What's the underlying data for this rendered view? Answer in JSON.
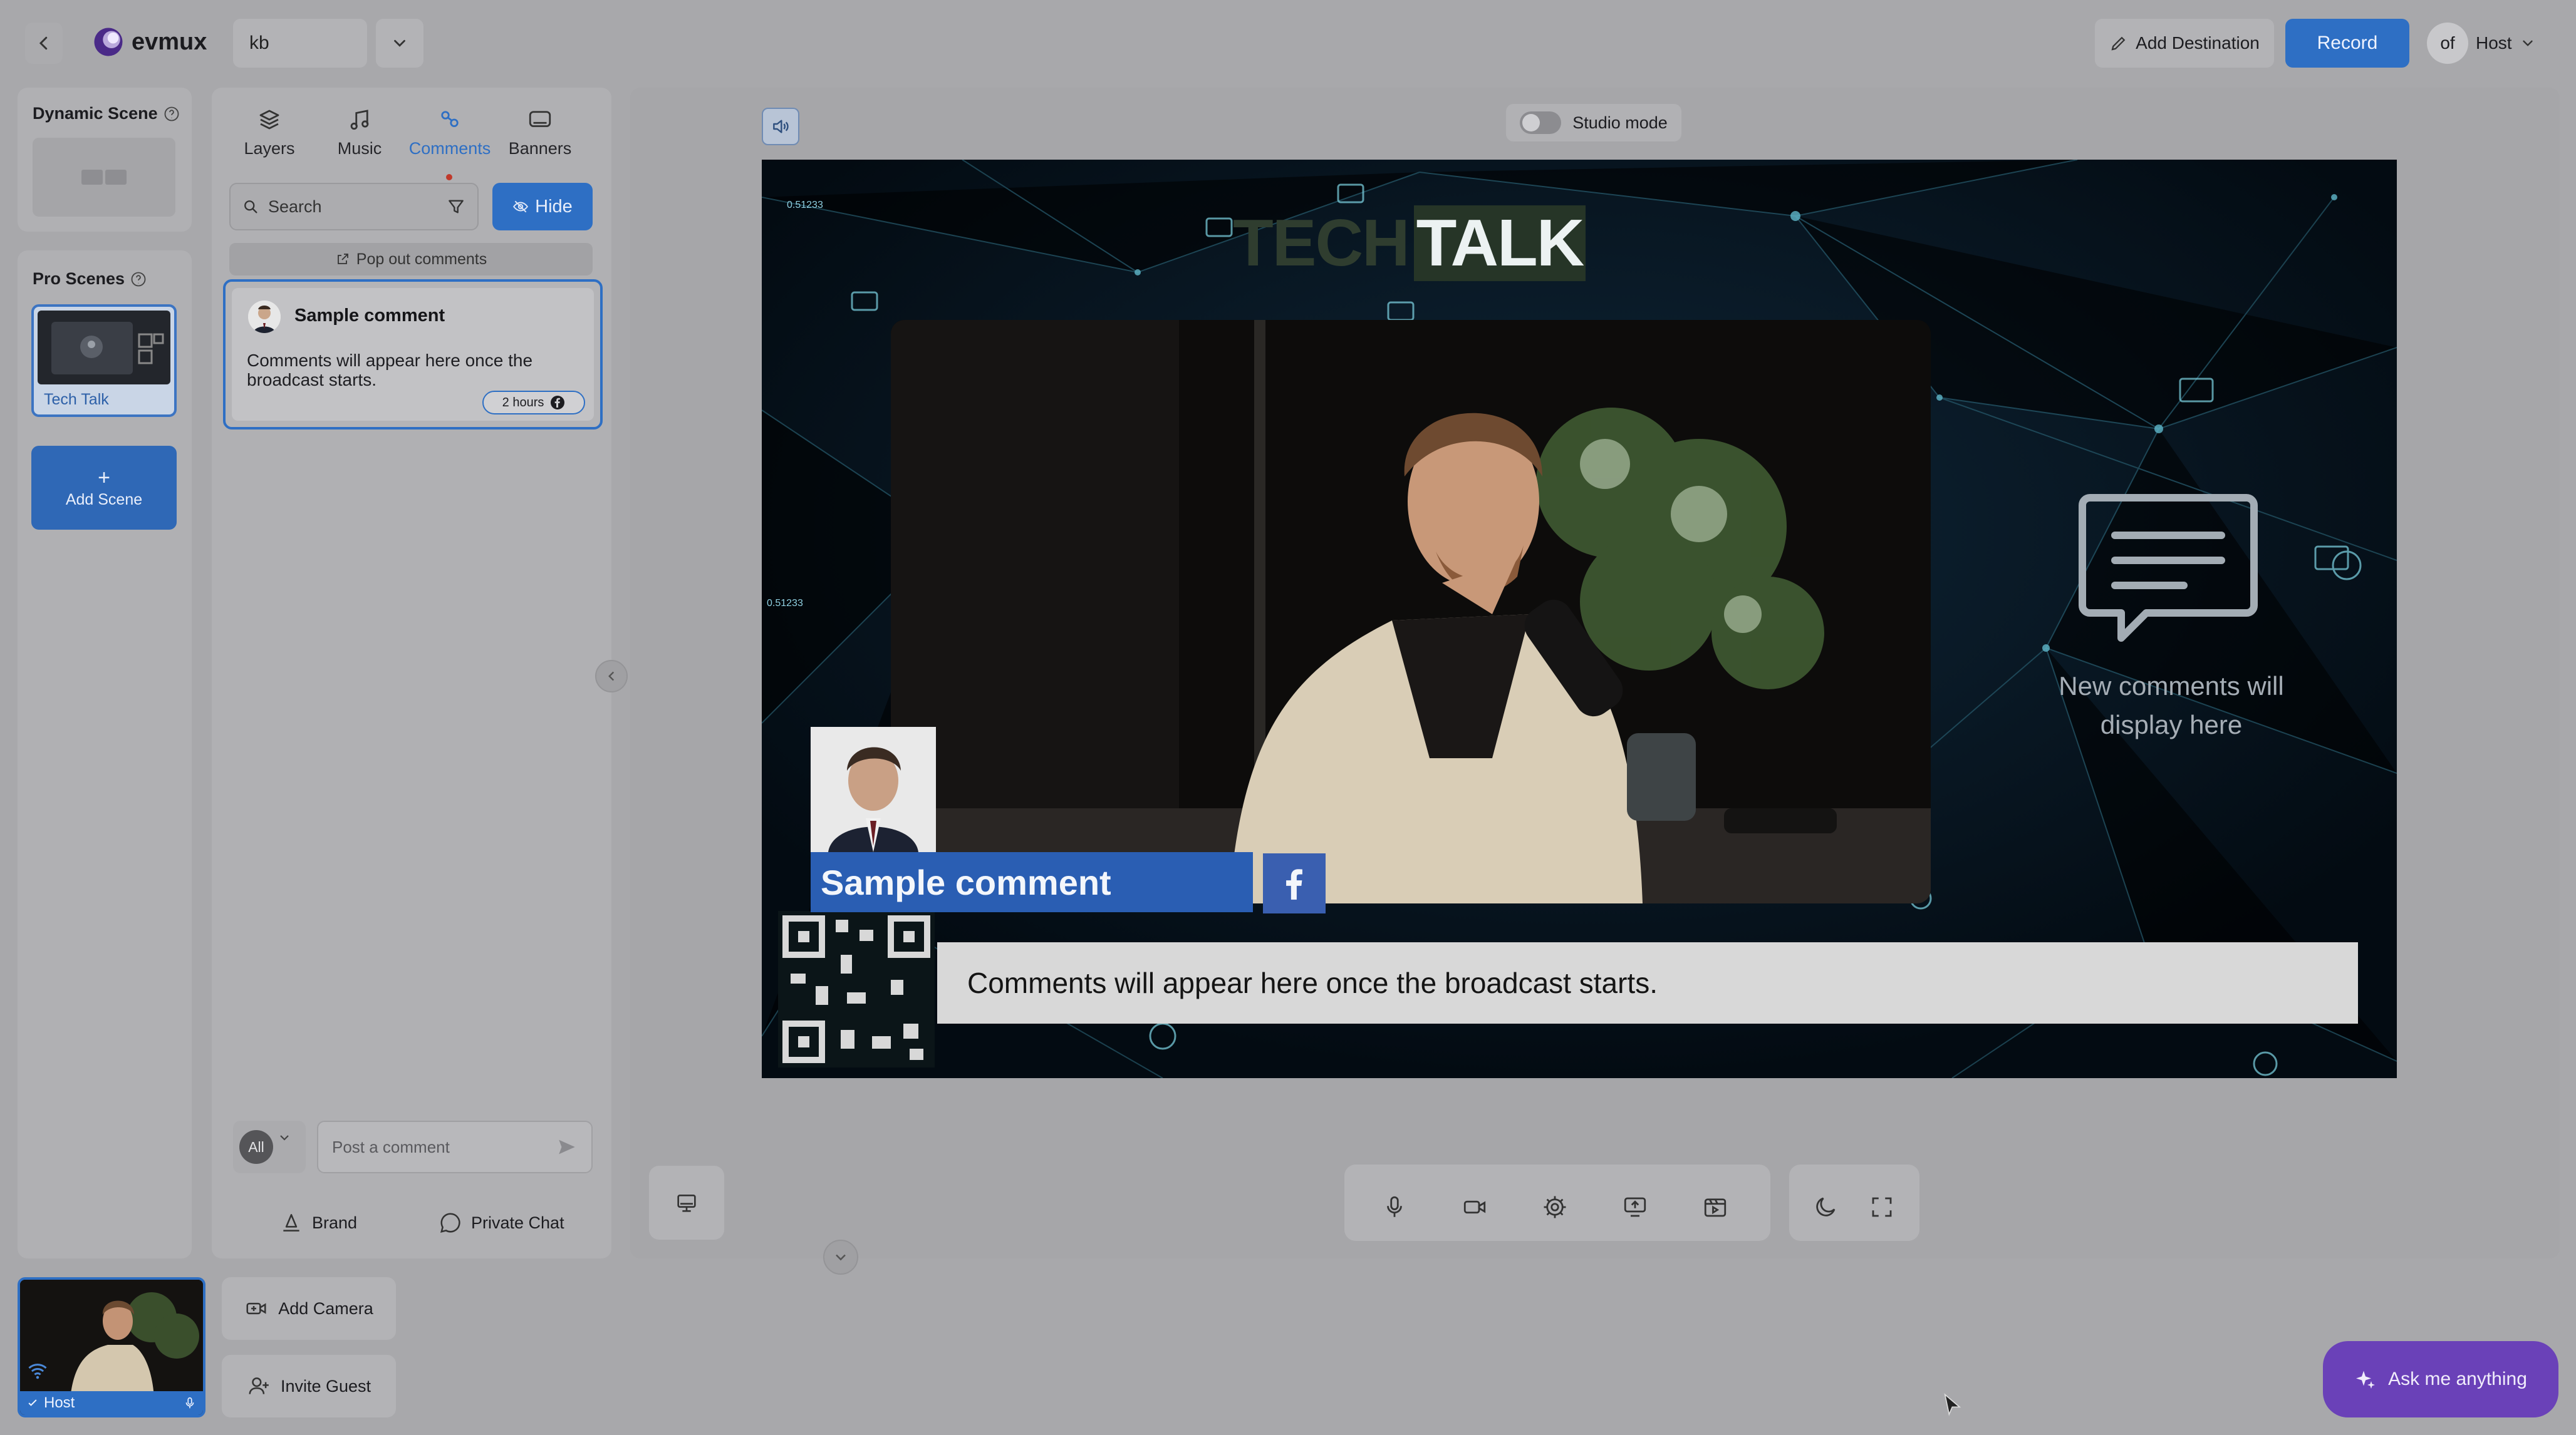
{
  "header": {
    "logo_text": "evmux",
    "studio_name": "kb",
    "add_destination_label": "Add Destination",
    "record_label": "Record",
    "host_label": "Host",
    "host_avatar_text": "of"
  },
  "left_sidebar": {
    "dynamic_scene_title": "Dynamic Scene",
    "pro_scenes_title": "Pro Scenes",
    "pro_scene_items": [
      {
        "label": "Tech Talk"
      }
    ],
    "add_scene_label": "Add Scene"
  },
  "tabs": [
    {
      "label": "Layers",
      "icon": "layers-icon"
    },
    {
      "label": "Music",
      "icon": "music-icon"
    },
    {
      "label": "Comments",
      "icon": "comments-icon",
      "active": true
    },
    {
      "label": "Banners",
      "icon": "banners-icon"
    }
  ],
  "comments_panel": {
    "search_placeholder": "Search",
    "hide_label": "Hide",
    "pop_out_label": "Pop out comments",
    "comment": {
      "author": "Sample comment",
      "text": "Comments will appear here once the broadcast starts.",
      "time": "2 hours",
      "source": "facebook"
    },
    "filter_value": "All",
    "post_placeholder": "Post a comment",
    "brand_label": "Brand",
    "private_chat_label": "Private Chat"
  },
  "stage": {
    "studio_mode_label": "Studio mode",
    "title_part1": "TECH",
    "title_part2": "TALK",
    "small_label_1": "0.51233",
    "small_label_2": "0.51233",
    "overlay_comment_author": "Sample comment",
    "overlay_comment_text": "Comments will appear here once the broadcast starts.",
    "placeholder_text": "New comments will display here"
  },
  "bottom": {
    "host_label": "Host",
    "add_camera_label": "Add Camera",
    "invite_guest_label": "Invite Guest",
    "ask_label": "Ask me anything"
  },
  "colors": {
    "accent": "#2e6fc4",
    "ask_purple": "#6a41b8",
    "facebook": "#3a5fb0"
  }
}
